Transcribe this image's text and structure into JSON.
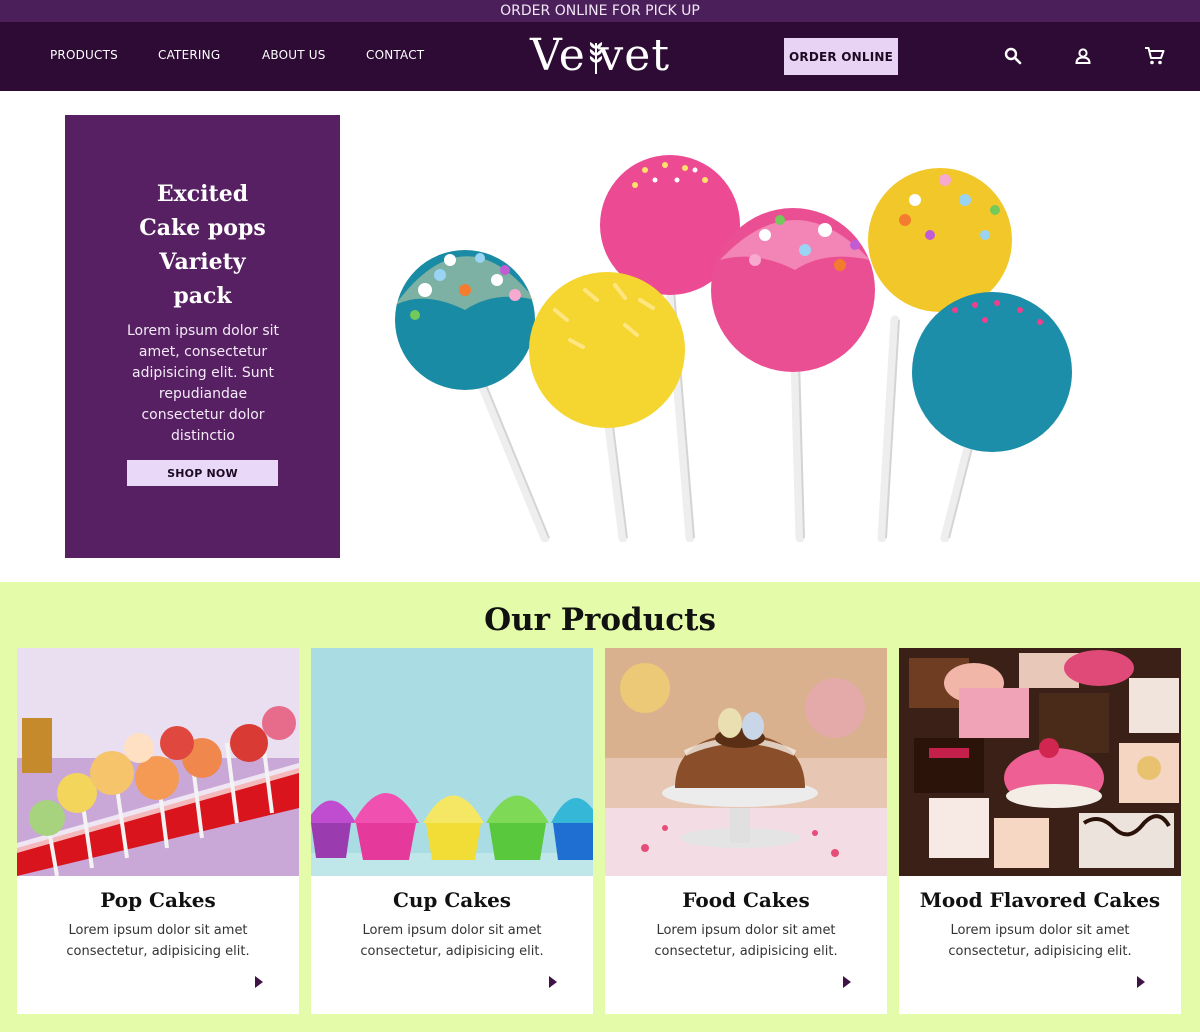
{
  "announcement": {
    "text": "ORDER ONLINE FOR PICK UP"
  },
  "header": {
    "nav": [
      "PRODUCTS",
      "CATERING",
      "ABOUT US",
      "CONTACT"
    ],
    "logo_text": {
      "before": "Ve",
      "after": "vet"
    },
    "order_button": "ORDER ONLINE",
    "icons": [
      "search-icon",
      "user-icon",
      "cart-icon"
    ]
  },
  "hero": {
    "title_lines": [
      "Excited",
      "Cake pops",
      "Variety",
      "pack"
    ],
    "body": "Lorem ipsum dolor sit amet, consectetur adipisicing elit. Sunt repudiandae consectetur dolor distinctio",
    "button": "SHOP NOW"
  },
  "products": {
    "heading": "Our Products",
    "items": [
      {
        "title": "Pop Cakes",
        "desc": "Lorem ipsum dolor sit amet consectetur, adipisicing elit."
      },
      {
        "title": "Cup Cakes",
        "desc": "Lorem ipsum dolor sit amet consectetur, adipisicing elit."
      },
      {
        "title": "Food Cakes",
        "desc": "Lorem ipsum dolor sit amet consectetur, adipisicing elit."
      },
      {
        "title": "Mood Flavored Cakes",
        "desc": "Lorem ipsum dolor sit amet consectetur, adipisicing elit."
      }
    ]
  },
  "colors": {
    "announce_bg": "#4b1f5a",
    "header_bg": "#2d0b34",
    "accent_button": "#e8d3f4",
    "hero_card": "#562062",
    "products_bg": "#e4fca9"
  }
}
